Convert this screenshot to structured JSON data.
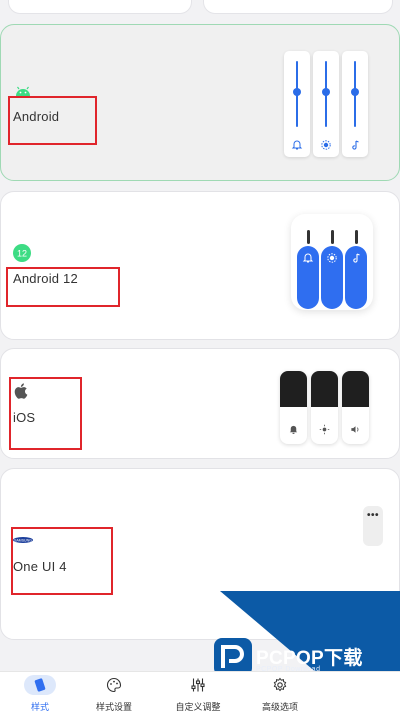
{
  "styles": [
    {
      "name": "Android",
      "selected": true
    },
    {
      "name": "Android 12",
      "selected": false
    },
    {
      "name": "iOS",
      "selected": false
    },
    {
      "name": "One UI 4",
      "selected": false
    }
  ],
  "android_sliders": [
    {
      "icon": "bell-icon",
      "level": 0.55
    },
    {
      "icon": "brightness-icon",
      "level": 0.55
    },
    {
      "icon": "music-note-icon",
      "level": 0.55
    }
  ],
  "android12_sliders": [
    {
      "icon": "bell-icon"
    },
    {
      "icon": "brightness-icon"
    },
    {
      "icon": "music-note-icon"
    }
  ],
  "ios_sliders": [
    {
      "icon": "bell-icon",
      "level": 0.55
    },
    {
      "icon": "brightness-icon",
      "level": 0.55
    },
    {
      "icon": "speaker-icon",
      "level": 0.55
    }
  ],
  "oneui": {
    "menu_icon": "more-dots-icon",
    "dots": "•••"
  },
  "watermark": {
    "title": "PCPOP下载",
    "subtitle": "PCPOP Download"
  },
  "tabs": [
    {
      "label": "样式",
      "icon": "style-icon",
      "active": true
    },
    {
      "label": "样式设置",
      "icon": "palette-icon",
      "active": false
    },
    {
      "label": "自定义调整",
      "icon": "sliders-icon",
      "active": false
    },
    {
      "label": "高级选项",
      "icon": "gear-icon",
      "active": false
    }
  ],
  "colors": {
    "accent": "#2f6ef0",
    "selected_border": "#9fd9b4",
    "highlight_box": "#e0252b",
    "android_green": "#3ddc84"
  }
}
